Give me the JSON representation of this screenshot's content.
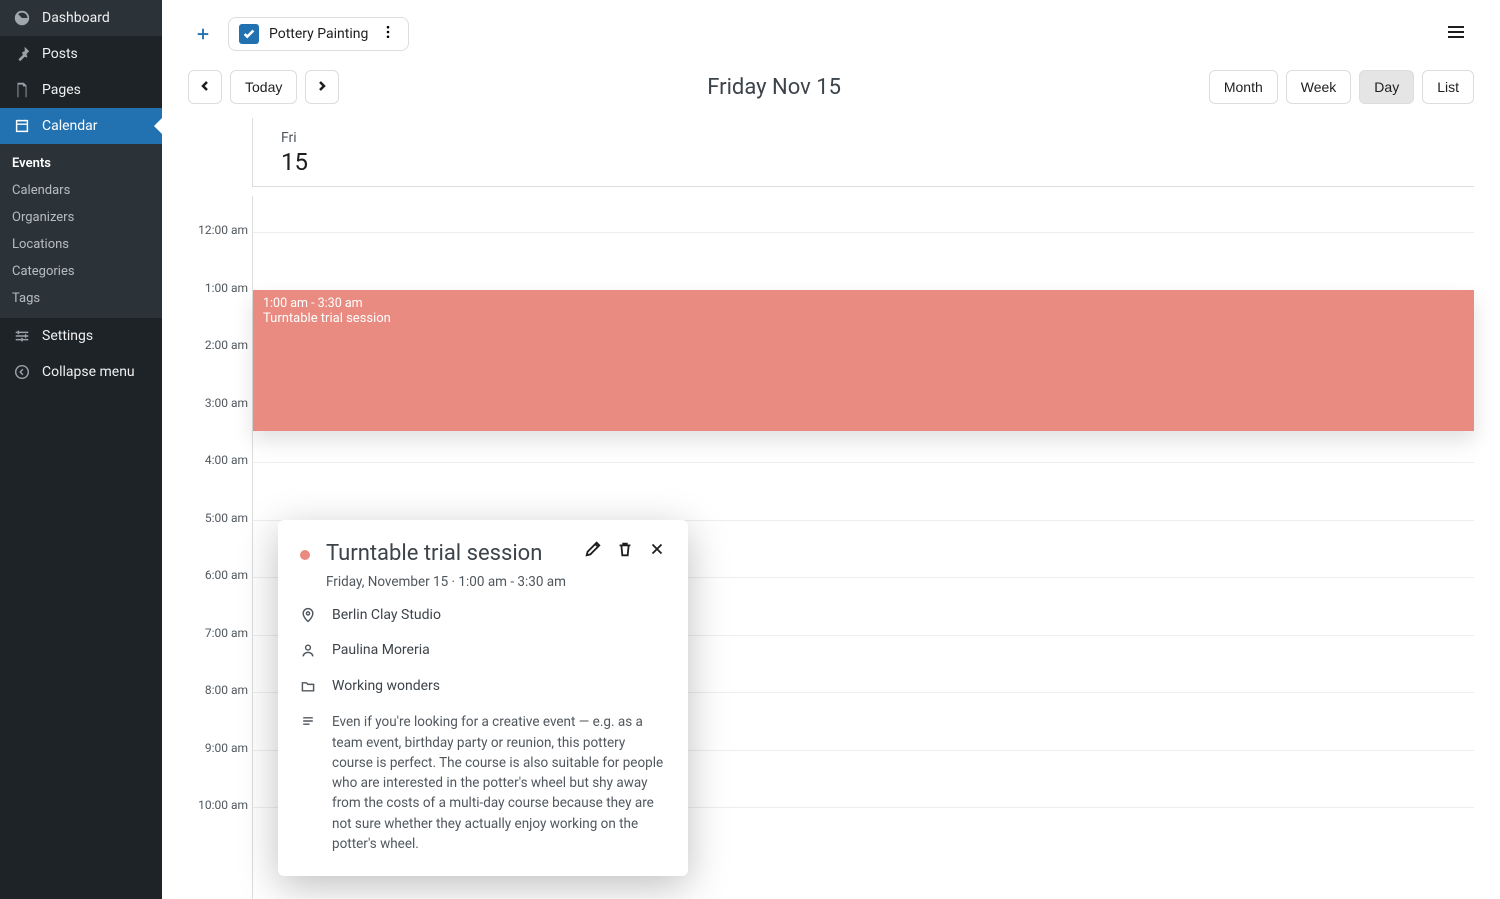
{
  "sidebar": {
    "items": [
      {
        "label": "Dashboard"
      },
      {
        "label": "Posts"
      },
      {
        "label": "Pages"
      },
      {
        "label": "Calendar"
      },
      {
        "label": "Settings"
      },
      {
        "label": "Collapse menu"
      }
    ],
    "submenu": [
      {
        "label": "Events"
      },
      {
        "label": "Calendars"
      },
      {
        "label": "Organizers"
      },
      {
        "label": "Locations"
      },
      {
        "label": "Categories"
      },
      {
        "label": "Tags"
      }
    ]
  },
  "topbar": {
    "filter_label": "Pottery Painting"
  },
  "nav": {
    "today": "Today",
    "title": "Friday Nov 15",
    "views": {
      "month": "Month",
      "week": "Week",
      "day": "Day",
      "list": "List"
    }
  },
  "day_header": {
    "dow": "Fri",
    "dom": "15"
  },
  "hours": [
    "12:00 am",
    "1:00 am",
    "2:00 am",
    "3:00 am",
    "4:00 am",
    "5:00 am",
    "6:00 am",
    "7:00 am",
    "8:00 am",
    "9:00 am",
    "10:00 am"
  ],
  "event": {
    "timerange": "1:00 am - 3:30 am",
    "name": "Turntable trial session",
    "color": "#e98b81"
  },
  "popover": {
    "title": "Turntable trial session",
    "subtitle": "Friday, November 15  ·  1:00 am - 3:30 am",
    "location": "Berlin Clay Studio",
    "organizer": "Paulina Moreria",
    "category": "Working wonders",
    "description": "Even if you're looking for a creative event — e.g. as a team event, birthday party or reunion, this pottery course is perfect. The course is also suitable for people who are interested in the potter's wheel but shy away from the costs of a multi-day course because they are not sure whether they actually enjoy working on the potter's wheel."
  }
}
